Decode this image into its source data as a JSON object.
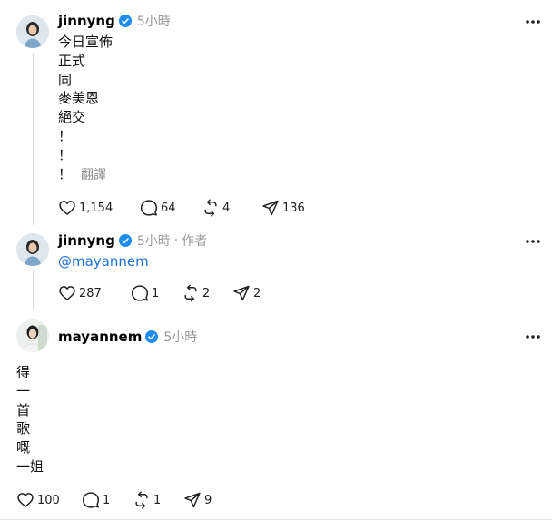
{
  "colors": {
    "verified": "#1d8cf0",
    "mention": "#1d6fd6",
    "muted": "#999999",
    "thread_line": "#d9d9d9"
  },
  "posts": [
    {
      "username": "jinnyng",
      "time": "5小時",
      "body": [
        "今日宣佈",
        "正式",
        "同",
        "麥美恩",
        "絕交",
        "！",
        "！",
        "！"
      ],
      "translate": "翻譯",
      "actions": {
        "likes": "1,154",
        "comments": "64",
        "reposts": "4",
        "shares": "136"
      }
    },
    {
      "username": "jinnyng",
      "time": "5小時",
      "role": "作者",
      "body": [
        "@mayannem"
      ],
      "actions": {
        "likes": "287",
        "comments": "1",
        "reposts": "2",
        "shares": "2"
      }
    },
    {
      "username": "mayannem",
      "time": "5小時",
      "body": [
        "得",
        "一",
        "首",
        "歌",
        "嘅",
        "一姐"
      ],
      "actions": {
        "likes": "100",
        "comments": "1",
        "reposts": "1",
        "shares": "9"
      }
    }
  ],
  "icons": {
    "verified": "verified-badge-icon",
    "more": "more-dots-icon",
    "like": "heart-icon",
    "comment": "comment-bubble-icon",
    "repost": "repost-icon",
    "share": "send-icon"
  }
}
